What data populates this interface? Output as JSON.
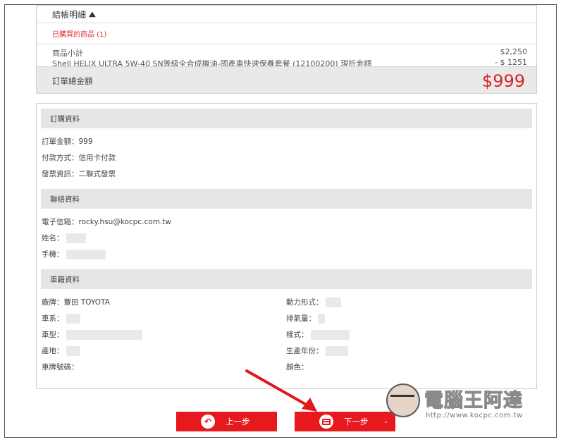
{
  "summary": {
    "title": "結帳明細",
    "caret": "⌃",
    "purchased_label": "已購買的商品 (1)",
    "line1_label": "商品小計",
    "line2_label": "Shell HELIX ULTRA 5W-40 SN等級全合成機油-國產車快速保養套餐 (12100200) 現折金額",
    "line1_value": "$2,250",
    "line2_value": "- $ 1251",
    "total_label": "訂單總金額",
    "total_value": "$999"
  },
  "order": {
    "heading": "訂購資料",
    "amount": "訂單金額：999",
    "payment": "付款方式：信用卡付款",
    "invoice": "發票資訊：二聯式發票"
  },
  "contact": {
    "heading": "聯絡資料",
    "email": "電子信箱：rocky.hsu@kocpc.com.tw",
    "name_label": "姓名：",
    "phone_label": "手機："
  },
  "vehicle": {
    "heading": "車籍資料",
    "brand": "廠牌：豐田 TOYOTA",
    "series_label": "車系：",
    "model_label": "車型：",
    "origin_label": "產地：",
    "plate_label": "車牌號碼：",
    "power_label": "動力形式：",
    "displacement_label": "排氣量：",
    "style_label": "樣式：",
    "year_label": "生產年份：",
    "color_label": "顏色："
  },
  "buttons": {
    "prev_label": "上一步",
    "next_label": "下一步",
    "next_caret": "⌄"
  },
  "watermark": {
    "brand": "電腦王阿達",
    "url": "http://www.kocpc.com.tw"
  },
  "colors": {
    "accent": "#e8181f",
    "total_red": "#d9262a",
    "section_bg": "#e5e5e5"
  }
}
